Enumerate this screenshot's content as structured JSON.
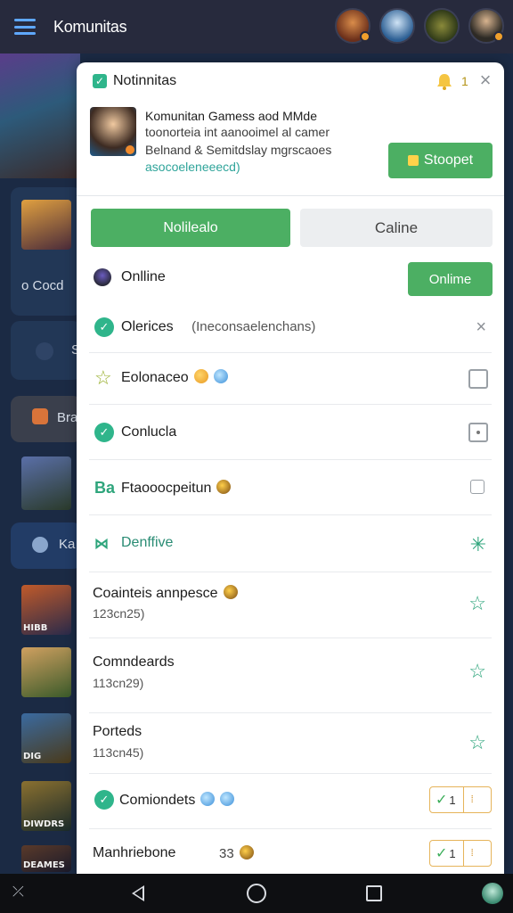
{
  "app": {
    "title": "Komunitas"
  },
  "background": {
    "items": [
      {
        "label": "o Cocd"
      },
      {
        "label": "S"
      },
      {
        "label": "Bra"
      },
      {
        "label": "Ka"
      }
    ],
    "thumb_labels": [
      "HIBB",
      "DIG",
      "DIWDRS",
      "DEAMES"
    ]
  },
  "panel": {
    "title": "Notinnitas",
    "bell_count": "1",
    "description": {
      "line1": "Komunitan Gamess aod MMde",
      "line2": "toonorteia int aanooimel al camer",
      "line3": "Belnand & Semitdslay mgrscaoes",
      "line4": "asocoeleneeecd)"
    },
    "stoopet_label": "Stoopet",
    "tabs": {
      "active": "Nolilealo",
      "inactive": "Caline"
    },
    "online": {
      "label": "Onlline",
      "button": "Onlime"
    },
    "rows": [
      {
        "label": "Olerices",
        "note": "(Ineconsaelenchans)"
      },
      {
        "label": "Eolonaceo"
      },
      {
        "label": "Conlucla"
      },
      {
        "label": "Ftaooocpeitun"
      },
      {
        "label": "Denffive"
      },
      {
        "label": "Coainteis annpesce",
        "sub": "123cn25)"
      },
      {
        "label": "Comndeards",
        "sub": "113cn29)"
      },
      {
        "label": "Porteds",
        "sub": "113cn45)"
      },
      {
        "label": "Comiondets",
        "pill_count": "1"
      },
      {
        "label": "Manhriebone",
        "count": "33",
        "pill_count": "1"
      }
    ]
  },
  "colors": {
    "accent_green": "#4caf63",
    "teal": "#2fb58b",
    "topbar": "#272a3d"
  }
}
